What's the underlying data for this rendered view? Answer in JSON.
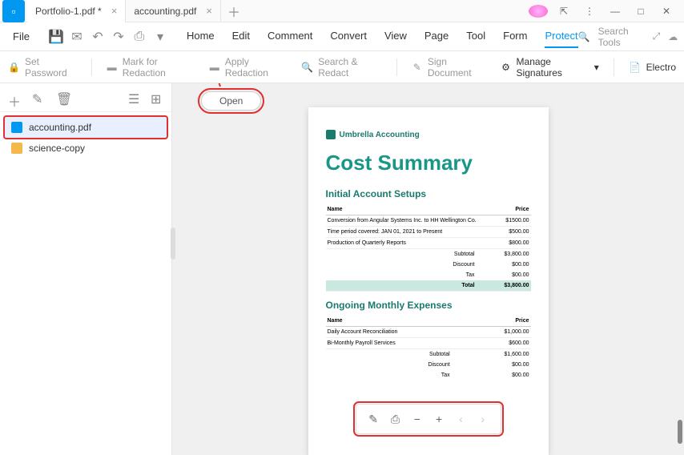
{
  "tabs": [
    {
      "label": "Portfolio-1.pdf *"
    },
    {
      "label": "accounting.pdf"
    }
  ],
  "menu": {
    "file": "File",
    "items": [
      "Home",
      "Edit",
      "Comment",
      "Convert",
      "View",
      "Page",
      "Tool",
      "Form",
      "Protect"
    ],
    "active": 8,
    "search": "Search Tools"
  },
  "toolbar": {
    "setPassword": "Set Password",
    "markRedaction": "Mark for Redaction",
    "applyRedaction": "Apply Redaction",
    "searchRedact": "Search & Redact",
    "signDocument": "Sign Document",
    "manageSignatures": "Manage Signatures",
    "electronic": "Electro"
  },
  "open": "Open",
  "sidebar": {
    "items": [
      {
        "name": "accounting.pdf",
        "type": "file"
      },
      {
        "name": "science-copy",
        "type": "folder"
      }
    ]
  },
  "doc": {
    "brand": "Umbrella Accounting",
    "title": "Cost Summary",
    "sec1": "Initial Account Setups",
    "sec2": "Ongoing Monthly Expenses",
    "h_name": "Name",
    "h_price": "Price",
    "t1": [
      {
        "n": "Conversion from Angular Systems Inc. to HH Wellington Co.",
        "p": "$1500.00"
      },
      {
        "n": "Time period covered: JAN 01, 2021 to Present",
        "p": "$500.00"
      },
      {
        "n": "Production of Quarterly Reports",
        "p": "$800.00"
      }
    ],
    "s1": [
      {
        "n": "Subtotal",
        "p": "$3,800.00"
      },
      {
        "n": "Discount",
        "p": "$00.00"
      },
      {
        "n": "Tax",
        "p": "$00.00"
      }
    ],
    "tot1": {
      "n": "Total",
      "p": "$3,800.00"
    },
    "t2": [
      {
        "n": "Daily Account Reconciliation",
        "p": "$1,000.00"
      },
      {
        "n": "Bi-Monthly Payroll Services",
        "p": "$600.00"
      }
    ],
    "s2": [
      {
        "n": "Subtotal",
        "p": "$1,600.00"
      },
      {
        "n": "Discount",
        "p": "$00.00"
      },
      {
        "n": "Tax",
        "p": "$00.00"
      }
    ]
  }
}
